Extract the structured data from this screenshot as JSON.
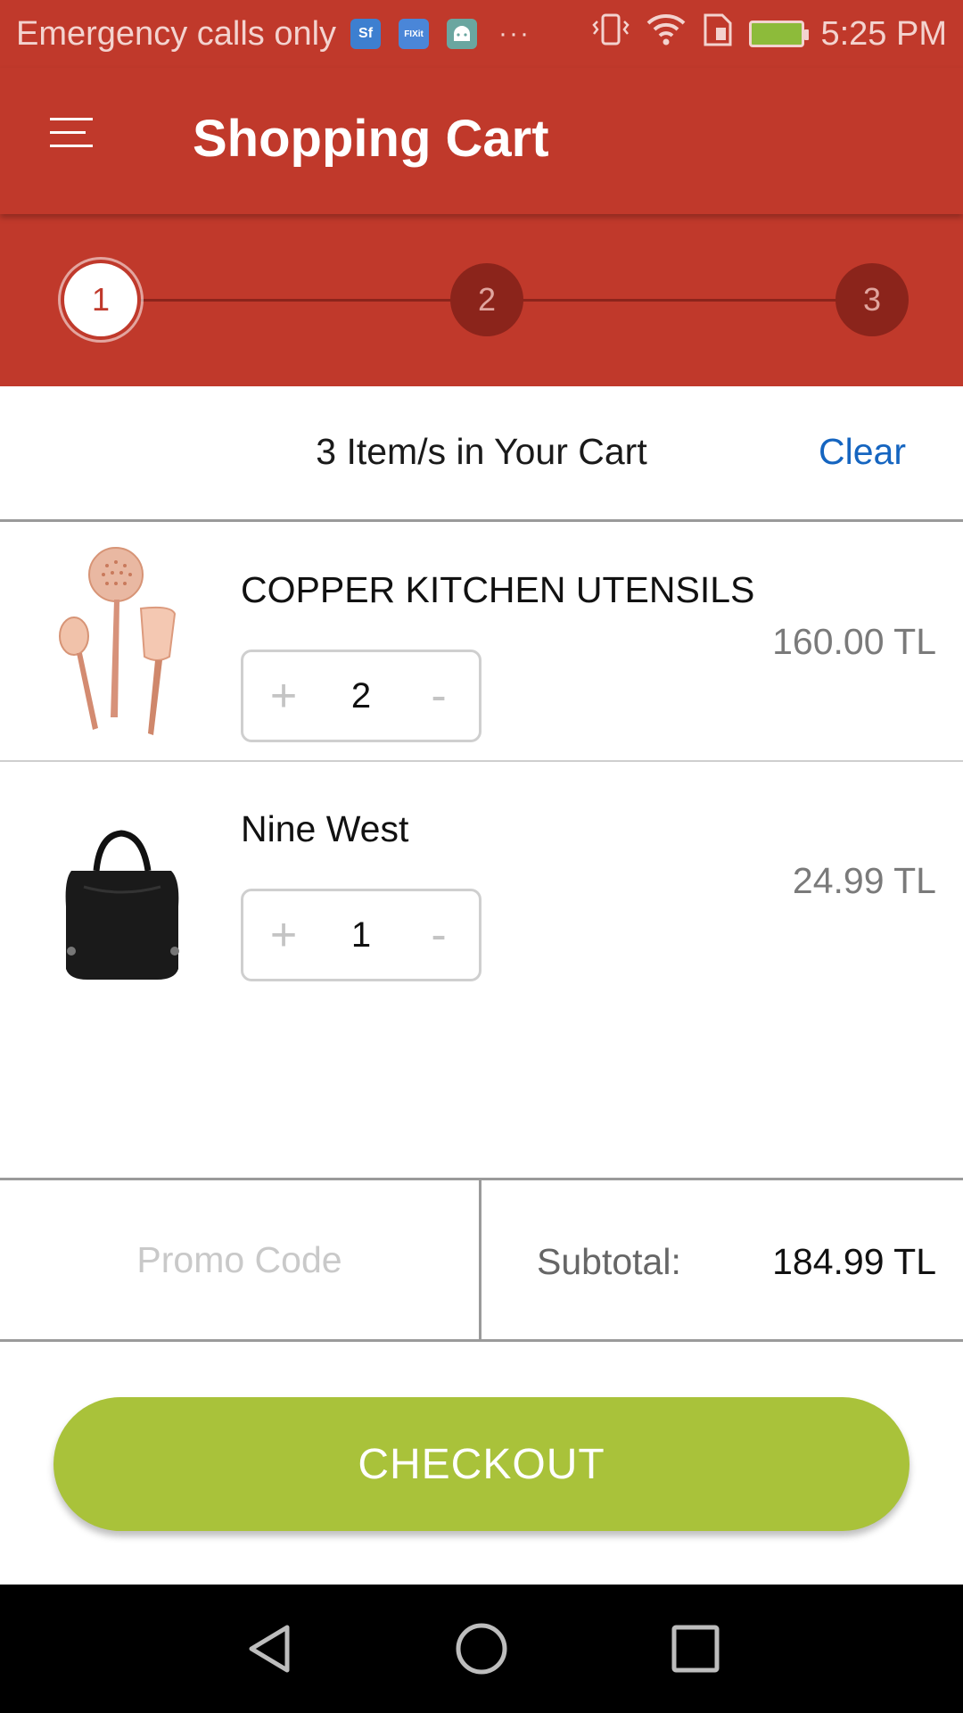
{
  "status_bar": {
    "carrier": "Emergency calls only",
    "notifications": [
      "sf-app-icon",
      "fixit-app-icon",
      "android-debug-icon",
      "more-icon"
    ],
    "sf_label": "Sf",
    "fix_label": "FIXit",
    "more": "···",
    "time": "5:25 PM",
    "icons": [
      "vibrate-icon",
      "wifi-icon",
      "sim-icon",
      "battery-charging-icon"
    ]
  },
  "app_bar": {
    "title": "Shopping Cart",
    "menu_icon": "hamburger-menu-icon"
  },
  "stepper": {
    "steps": [
      "1",
      "2",
      "3"
    ],
    "active_step": 1
  },
  "cart": {
    "count_label": "3 Item/s in Your Cart",
    "clear_label": "Clear",
    "items": [
      {
        "name": "COPPER KITCHEN UTENSILS",
        "quantity": "2",
        "price": "160.00 TL",
        "plus": "+",
        "minus": "-",
        "image": "copper-utensils-image"
      },
      {
        "name": "Nine West",
        "quantity": "1",
        "price": "24.99 TL",
        "plus": "+",
        "minus": "-",
        "image": "black-handbag-image"
      }
    ]
  },
  "summary": {
    "promo_placeholder": "Promo Code",
    "subtotal_label": "Subtotal:",
    "subtotal_value": "184.99 TL"
  },
  "checkout_label": "CHECKOUT",
  "colors": {
    "primary": "#c0392b",
    "step_inactive": "#8b241b",
    "link": "#1565c0",
    "checkout": "#a9c23a"
  },
  "nav_bar": [
    "back-icon",
    "home-icon",
    "recents-icon"
  ]
}
